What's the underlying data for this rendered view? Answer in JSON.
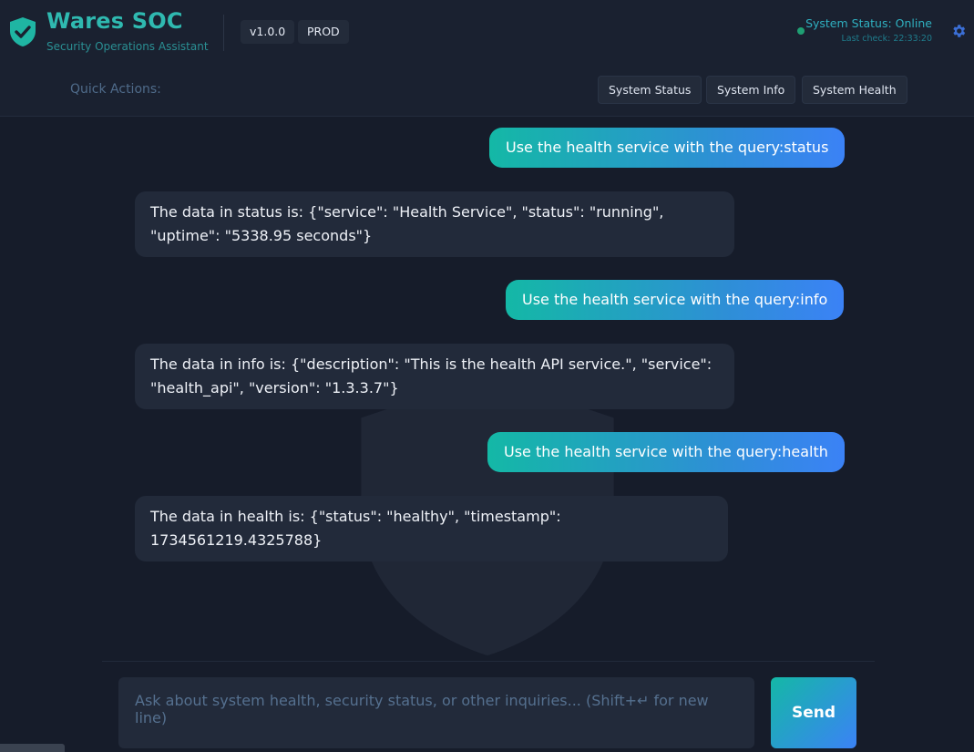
{
  "header": {
    "brand_icon": "shield-check-icon",
    "title": "Wares SOC",
    "subtitle": "Security Operations Assistant",
    "version_badge": "v1.0.0",
    "env_badge": "PROD",
    "status_text": "System Status: Online",
    "last_check": "Last check: 22:33:20",
    "settings_icon": "gear-icon"
  },
  "quick_actions": {
    "label": "Quick Actions:",
    "buttons": [
      "System Status",
      "System Info",
      "System Health"
    ]
  },
  "messages": [
    {
      "role": "user",
      "text": "Use the health service with the query:status"
    },
    {
      "role": "assistant",
      "text": "The data in status is: {\"service\": \"Health Service\", \"status\": \"running\", \"uptime\": \"5338.95 seconds\"}"
    },
    {
      "role": "user",
      "text": "Use the health service with the query:info"
    },
    {
      "role": "assistant",
      "text": "The data in info is: {\"description\": \"This is the health API service.\", \"service\": \"health_api\", \"version\": \"1.3.3.7\"}"
    },
    {
      "role": "user",
      "text": "Use the health service with the query:health"
    },
    {
      "role": "assistant",
      "text": "The data in health is: {\"status\": \"healthy\", \"timestamp\": 1734561219.4325788}"
    }
  ],
  "composer": {
    "placeholder": "Ask about system health, security status, or other inquiries... (Shift+↵ for new line)",
    "value": "",
    "send_label": "Send"
  },
  "colors": {
    "accent_teal": "#14b8a6",
    "accent_blue": "#3b82f6",
    "online": "#1f9f73",
    "background": "#161c2a"
  }
}
